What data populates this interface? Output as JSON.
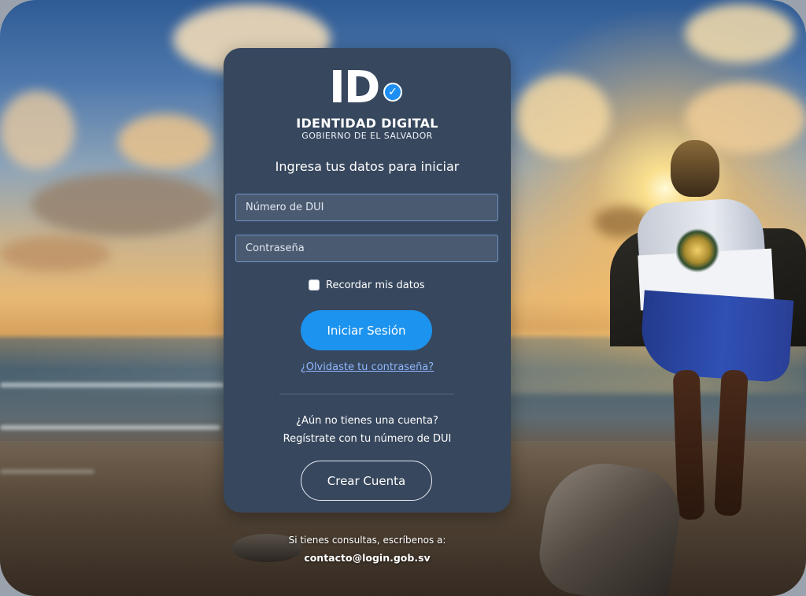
{
  "brand": {
    "logo_text": "ID",
    "badge_icon": "verified-check-icon",
    "title": "IDENTIDAD DIGITAL",
    "subtitle": "GOBIERNO DE EL SALVADOR"
  },
  "login": {
    "intro": "Ingresa tus datos para iniciar",
    "dui_placeholder": "Número de DUI",
    "dui_value": "",
    "password_placeholder": "Contraseña",
    "password_value": "",
    "remember_label": "Recordar mis datos",
    "remember_checked": false,
    "submit_label": "Iniciar Sesión",
    "forgot_link": "¿Olvidaste tu contraseña?"
  },
  "register": {
    "question": "¿Aún no tienes una cuenta?",
    "hint": "Regístrate con tu número de DUI",
    "button_label": "Crear Cuenta"
  },
  "footer": {
    "contact_text": "Si tienes consultas, escríbenos a:",
    "contact_email": "contacto@login.gob.sv"
  },
  "colors": {
    "card_bg": "#37475d",
    "primary_button": "#1c93ee",
    "link": "#8fb7ff",
    "input_border": "#6f93c9"
  }
}
